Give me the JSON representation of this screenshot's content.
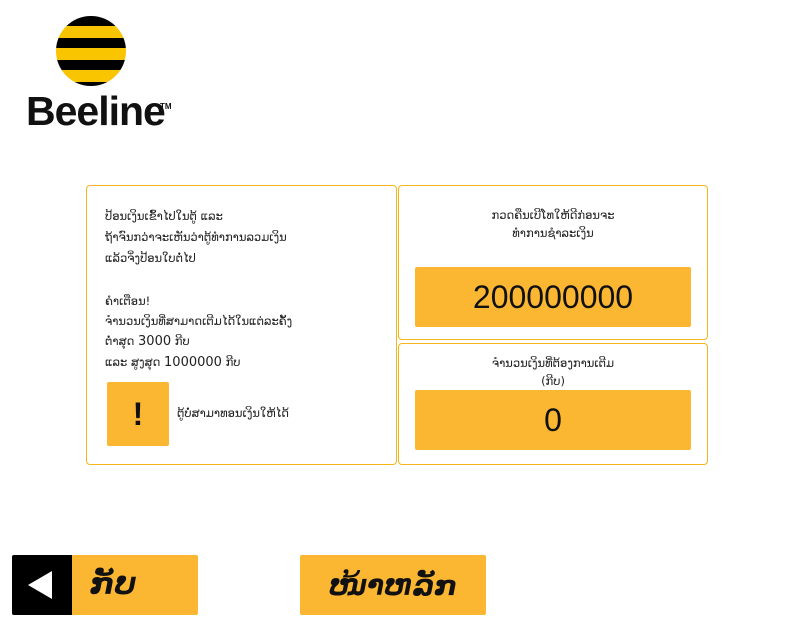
{
  "logo": {
    "text": "Beeline",
    "tm": "TM",
    "icon": "beeline-ball-icon",
    "colors": {
      "black": "#000000",
      "yellow": "#f9c400"
    }
  },
  "instructions": {
    "line1": "ປ້ອນເງິນເຂົ້າໄປໃນຕູ້ ແລະ",
    "line2": "ຖ້າຈົນກວ່າຈະເຫັນວ່າຕູ້ທຳການລວມເງິນ",
    "line3": "ແລ້ວຈິ່ງປ້ອນໃບຕໍ່ໄປ"
  },
  "warning": {
    "title": "ຄຳເຕືອນ!",
    "line1": "ຈຳນວນເງິນທີ່ສາມາດເຕີມໄດ້ໃນແຕ່ລະຄັ້ງ",
    "min_prefix": "ຕ່ຳສຸດ",
    "min_value": "3000",
    "min_unit": "ກີບ",
    "max_prefix": "ແລະ ສູງສຸດ",
    "max_value": "1000000",
    "max_unit": "ກີບ"
  },
  "notice": {
    "button_label": "!",
    "text": "ຕູ້ບໍ່ສາມາທອນເງິນໃຫ້ໄດ້"
  },
  "balance": {
    "heading_line1": "ກວດຄືນເບີໂທໃຫ້ດີກ່ອນຈະ",
    "heading_line2": "ທຳການຊຳລະເງິນ",
    "value": "200000000"
  },
  "amount": {
    "heading_line1": "ຈຳນວນເງິນທີ່ຕ້ອງການເຕີມ",
    "heading_line2": "(ກີບ)",
    "value": "0"
  },
  "buttons": {
    "back_label": "ກັບ",
    "back_icon": "left-triangle-icon",
    "home_label": "ໜ້າຫລັກ"
  },
  "colors": {
    "accent": "#fbb632",
    "border": "#f5b51c"
  }
}
